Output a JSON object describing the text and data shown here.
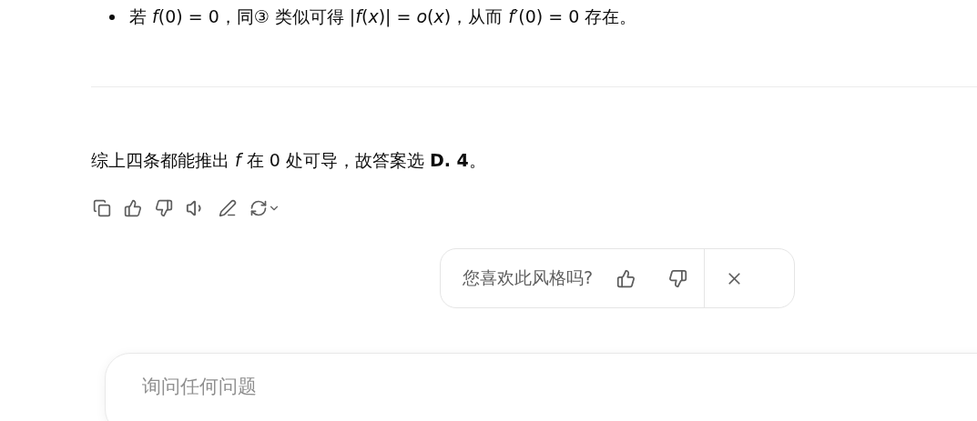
{
  "list_items": [
    {
      "text": "若 *f*(0) = 0，同③ 类似可得 |*f*(*x*)| = *o*(*x*)，从而 *f*′(0) = 0 存在。"
    }
  ],
  "summary": "综上四条都能推出 *f* 在 0 处可导，故答案选 **D. 4**。",
  "feedback": {
    "question": "您喜欢此风格吗?"
  },
  "composer": {
    "placeholder": "询问任何问题"
  }
}
